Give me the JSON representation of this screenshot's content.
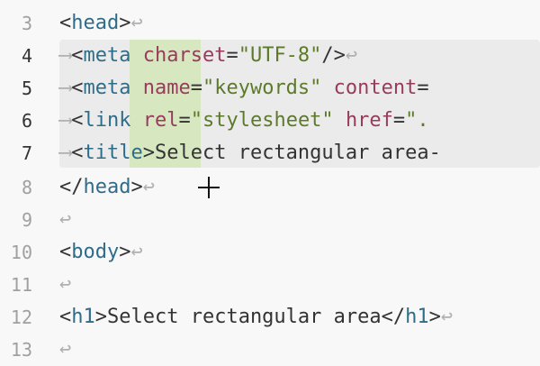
{
  "symbols": {
    "eol": "↩",
    "tab": "⟶",
    "lt": "<",
    "gt": ">",
    "lt_slash": "</",
    "self_close": "/>",
    "eq": "=",
    "space": " "
  },
  "line_numbers": [
    "3",
    "4",
    "5",
    "6",
    "7",
    "8",
    "9",
    "10",
    "11",
    "12",
    "13"
  ],
  "lines": {
    "l3": {
      "tag": "head"
    },
    "l4": {
      "tag": "meta",
      "attr": "charset",
      "val": "\"UTF-8\""
    },
    "l5": {
      "tag": "meta",
      "attr1": "name",
      "val1": "\"keywords\"",
      "attr2": "content"
    },
    "l6": {
      "tag": "link",
      "attr1": "rel",
      "val1": "\"stylesheet\"",
      "attr2": "href",
      "val2": "\"."
    },
    "l7": {
      "tag": "title",
      "text": "Select rectangular area-"
    },
    "l8": {
      "tag": "head"
    },
    "l10": {
      "tag": "body"
    },
    "l12": {
      "tag": "h1",
      "text": "Select rectangular area"
    }
  },
  "colors": {
    "tag": "#2e6d8a",
    "attr": "#9a3a5c",
    "val": "#5d7a2a",
    "selection": "#ebebeb",
    "rect_selection": "#d7e8c1"
  },
  "cursor_icon": "crosshair-cursor-icon"
}
